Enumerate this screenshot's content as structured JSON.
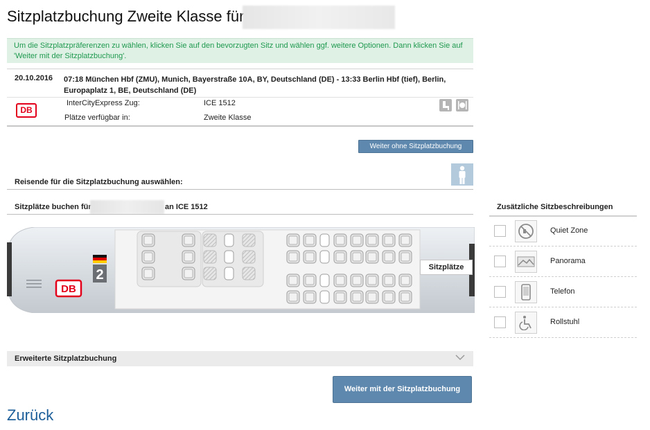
{
  "page": {
    "title": "Sitzplatzbuchung Zweite Klasse für",
    "info": "Um die Sitzplatzpräferenzen zu wählen, klicken Sie auf den bevorzugten Sitz und wählen ggf. weitere Optionen. Dann klicken Sie auf 'Weiter mit der Sitzplatzbuchung'."
  },
  "journey": {
    "date": "20.10.2016",
    "route": "07:18 München Hbf (ZMU), Munich, Bayerstraße 10A, BY, Deutschland (DE) - 13:33 Berlin Hbf (tief), Berlin, Europaplatz 1, BE, Deutschland (DE)",
    "operator_logo": "DB",
    "train_label": "InterCityExpress Zug:",
    "train_value": "ICE 1512",
    "seats_label": "Plätze verfügbar in:",
    "seats_value": "Zweite Klasse",
    "amenity_icons": [
      "seat-icon",
      "restaurant-icon"
    ]
  },
  "buttons": {
    "skip": "Weiter ohne Sitzplatzbuchung",
    "continue": "Weiter mit der Sitzplatzbuchung",
    "back": "Zurück"
  },
  "travellers": {
    "label": "Reisende für die Sitzplatzbuchung auswählen:"
  },
  "booking": {
    "prefix": "Sitzplätze buchen für",
    "suffix": "an ICE 1512",
    "coach_class": "2",
    "coach_logo": "DB",
    "tab_label": "Sitzplätze"
  },
  "extended": {
    "label": "Erweiterte Sitzplatzbuchung"
  },
  "sidebar": {
    "title": "Zusätzliche Sitzbeschreibungen",
    "options": [
      {
        "label": "Quiet Zone",
        "icon": "quiet-zone-icon"
      },
      {
        "label": "Panorama",
        "icon": "panorama-icon"
      },
      {
        "label": "Telefon",
        "icon": "phone-icon"
      },
      {
        "label": "Rollstuhl",
        "icon": "wheelchair-icon"
      }
    ]
  },
  "colors": {
    "accent": "#5e88ad",
    "info_bg": "#dff0e5",
    "info_text": "#1f9a4f",
    "db_red": "#e3001b",
    "link": "#1d5f9a"
  }
}
